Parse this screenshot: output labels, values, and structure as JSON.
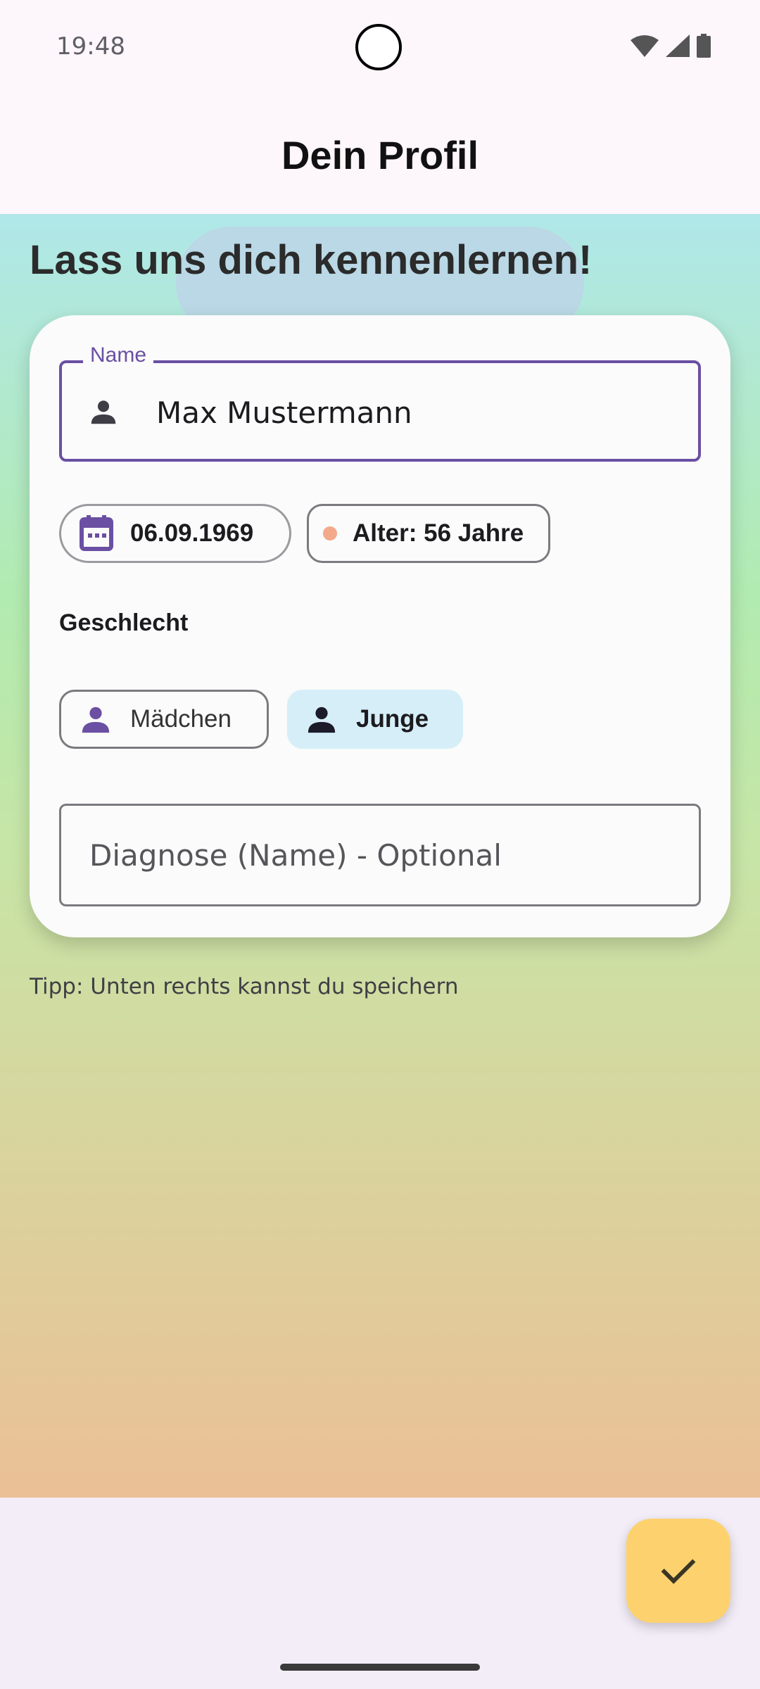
{
  "status_bar": {
    "time": "19:48",
    "icons": [
      "wifi-icon",
      "cellular-signal-icon",
      "battery-icon"
    ]
  },
  "app_bar": {
    "title": "Dein Profil"
  },
  "headline": "Lass uns dich kennenlernen!",
  "form": {
    "name_field": {
      "label": "Name",
      "value": "Max Mustermann",
      "icon": "person-icon"
    },
    "birthdate_chip": {
      "value": "06.09.1969",
      "icon": "calendar-icon"
    },
    "age_chip": {
      "label": "Alter: 56 Jahre"
    },
    "gender": {
      "label": "Geschlecht",
      "options": [
        {
          "label": "Mädchen",
          "selected": false,
          "icon": "person-icon"
        },
        {
          "label": "Junge",
          "selected": true,
          "icon": "person-icon"
        }
      ]
    },
    "diagnosis_field": {
      "placeholder": "Diagnose (Name) - Optional",
      "value": ""
    }
  },
  "tip": "Tipp: Unten rechts kannst du speichern",
  "fab": {
    "icon": "check-icon"
  },
  "colors": {
    "accent": "#6A4FA3",
    "fab": "#FDD26E",
    "selected_chip": "#D6EEF8",
    "age_dot": "#F3A98A"
  }
}
